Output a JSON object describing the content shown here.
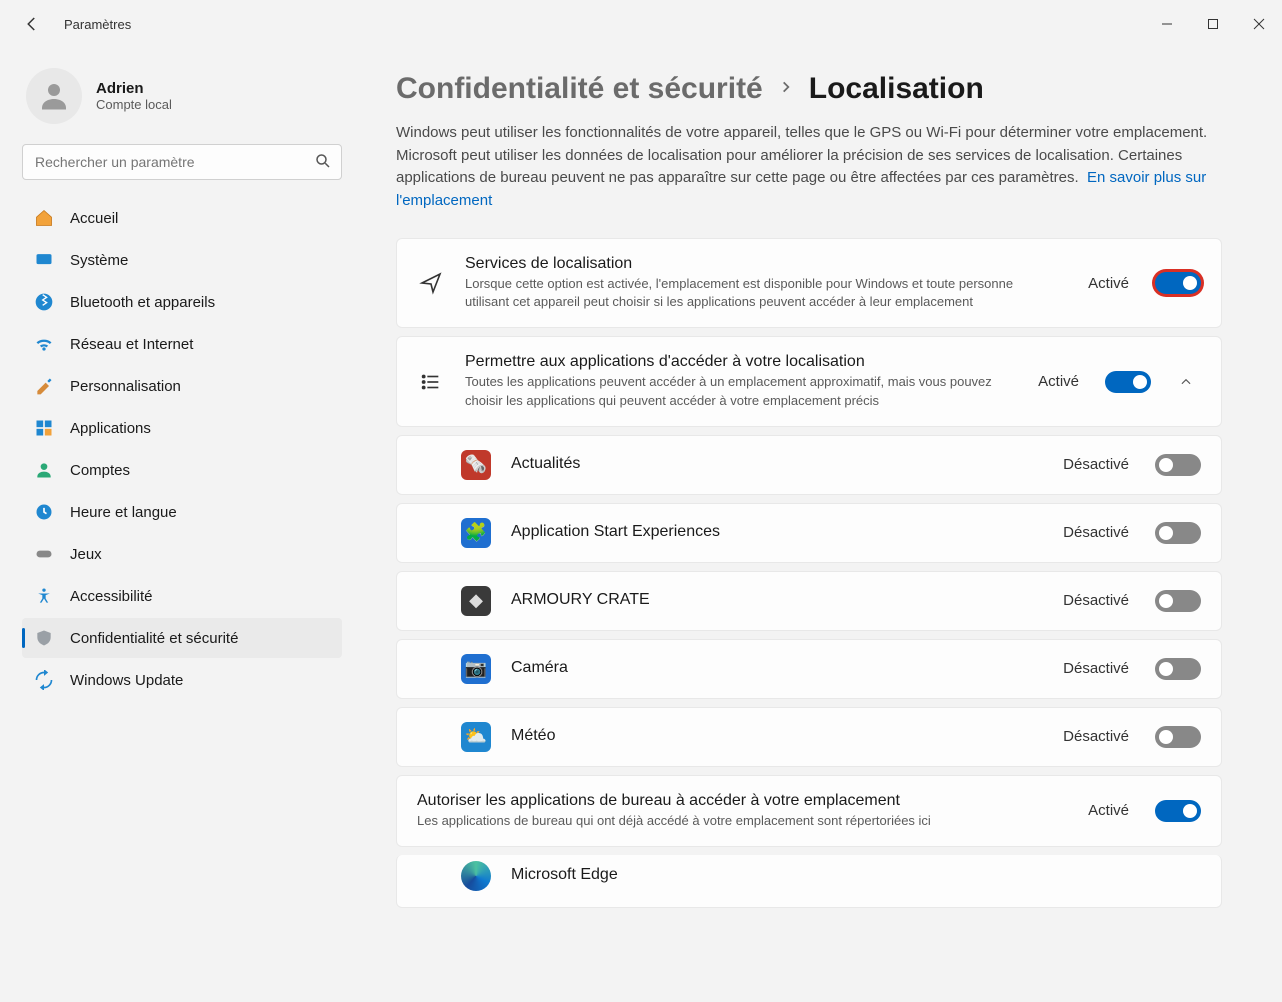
{
  "window": {
    "title": "Paramètres"
  },
  "user": {
    "name": "Adrien",
    "sub": "Compte local"
  },
  "search": {
    "placeholder": "Rechercher un paramètre"
  },
  "nav": {
    "home": "Accueil",
    "system": "Système",
    "bluetooth": "Bluetooth et appareils",
    "network": "Réseau et Internet",
    "personalization": "Personnalisation",
    "apps": "Applications",
    "accounts": "Comptes",
    "time": "Heure et langue",
    "games": "Jeux",
    "accessibility": "Accessibilité",
    "privacy": "Confidentialité et sécurité",
    "update": "Windows Update"
  },
  "breadcrumb": {
    "parent": "Confidentialité et sécurité",
    "current": "Localisation"
  },
  "intro": {
    "text": "Windows peut utiliser les fonctionnalités de votre appareil, telles que le GPS ou Wi-Fi pour déterminer votre emplacement. Microsoft peut utiliser les données de localisation pour améliorer la précision de ses services de localisation. Certaines applications de bureau peuvent ne pas apparaître sur cette page ou être affectées par ces paramètres.",
    "link": "En savoir plus sur l'emplacement"
  },
  "location_services": {
    "title": "Services de localisation",
    "desc": "Lorsque cette option est activée, l'emplacement est disponible pour Windows et toute personne utilisant cet appareil peut choisir si les applications peuvent accéder à leur emplacement",
    "status": "Activé",
    "on": true,
    "highlight": true
  },
  "app_access": {
    "title": "Permettre aux applications d'accéder à votre localisation",
    "desc": "Toutes les applications peuvent accéder à un emplacement approximatif, mais vous pouvez choisir les applications qui peuvent accéder à votre emplacement précis",
    "status": "Activé",
    "on": true
  },
  "apps": [
    {
      "name": "Actualités",
      "status": "Désactivé",
      "on": false,
      "bg": "#c0392b"
    },
    {
      "name": "Application Start Experiences",
      "status": "Désactivé",
      "on": false,
      "bg": "#1f6fd0"
    },
    {
      "name": "ARMOURY CRATE",
      "status": "Désactivé",
      "on": false,
      "bg": "#3a3a3a"
    },
    {
      "name": "Caméra",
      "status": "Désactivé",
      "on": false,
      "bg": "#1f6fd0"
    },
    {
      "name": "Météo",
      "status": "Désactivé",
      "on": false,
      "bg": "#1f87d0"
    }
  ],
  "desktop_apps": {
    "title": "Autoriser les applications de bureau à accéder à votre emplacement",
    "desc": "Les applications de bureau qui ont déjà accédé à votre emplacement sont répertoriées ici",
    "status": "Activé",
    "on": true,
    "edge": "Microsoft Edge"
  },
  "app_glyphs": [
    "🗞️",
    "🧩",
    "◆",
    "📷",
    "⛅"
  ]
}
